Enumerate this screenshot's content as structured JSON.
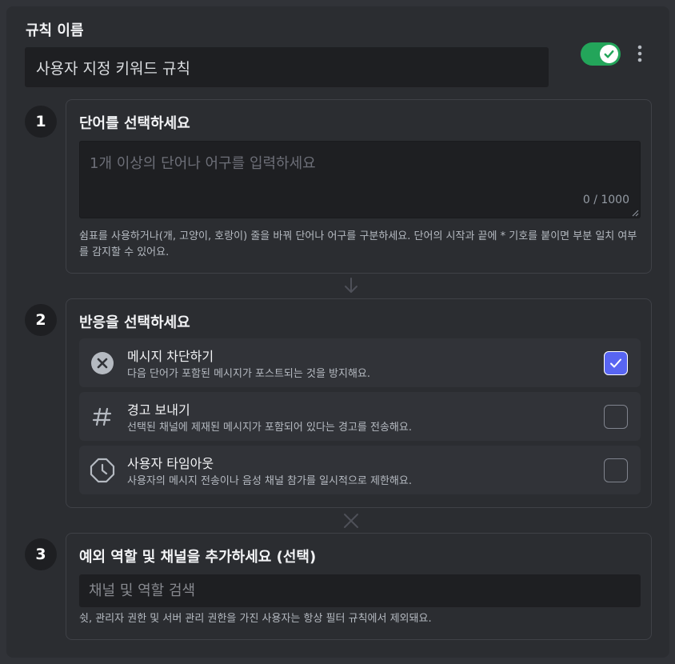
{
  "header": {
    "rule_label": "규칙 이름",
    "rule_name_value": "사용자 지정 키워드 규칙",
    "enabled": true
  },
  "step1": {
    "number": "1",
    "title": "단어를 선택하세요",
    "placeholder": "1개 이상의 단어나 어구를 입력하세요",
    "value": "",
    "counter": "0 / 1000",
    "help": "쉼표를 사용하거나(개, 고양이, 호랑이) 줄을 바꿔 단어나 어구를 구분하세요. 단어의 시작과 끝에 * 기호를 붙이면 부분 일치 여부를 감지할 수 있어요."
  },
  "step2": {
    "number": "2",
    "title": "반응을 선택하세요",
    "options": [
      {
        "icon": "block-x-icon",
        "title": "메시지 차단하기",
        "description": "다음 단어가 포함된 메시지가 포스트되는 것을 방지해요.",
        "checked": true
      },
      {
        "icon": "hash-icon",
        "title": "경고 보내기",
        "description": "선택된 채널에 제재된 메시지가 포함되어 있다는 경고를 전송해요.",
        "checked": false
      },
      {
        "icon": "clock-icon",
        "title": "사용자 타임아웃",
        "description": "사용자의 메시지 전송이나 음성 채널 참가를 일시적으로 제한해요.",
        "checked": false
      }
    ]
  },
  "step3": {
    "number": "3",
    "title": "예외 역할 및 채널을 추가하세요 (선택)",
    "search_placeholder": "채널 및 역할 검색",
    "help": "쉿, 관리자 권한 및 서버 관리 권한을 가진 사용자는 항상 필터 규칙에서 제외돼요."
  },
  "colors": {
    "toggle_on": "#23a55a",
    "checkbox_checked": "#5865f2",
    "panel_bg": "#2b2d31",
    "input_bg": "#1e1f22"
  }
}
